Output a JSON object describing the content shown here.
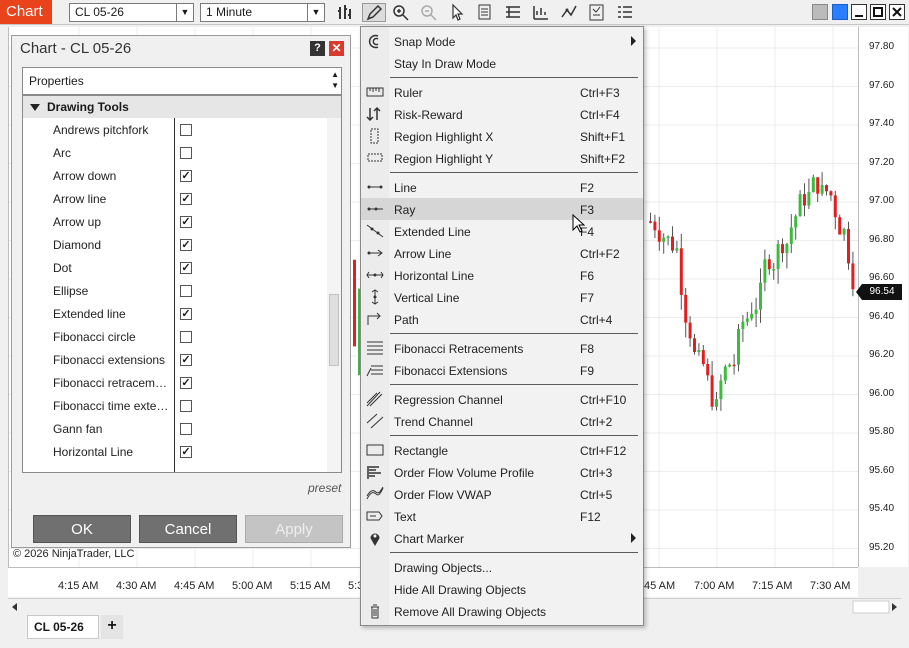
{
  "toolbar": {
    "chart_label": "Chart",
    "instrument": "CL 05-26",
    "interval": "1 Minute"
  },
  "dialog": {
    "title": "Chart - CL 05-26",
    "help_label": "?",
    "close_label": "✕",
    "properties_label": "Properties",
    "section_label": "Drawing Tools",
    "items": [
      {
        "label": "Andrews pitchfork",
        "checked": false
      },
      {
        "label": "Arc",
        "checked": false
      },
      {
        "label": "Arrow down",
        "checked": true
      },
      {
        "label": "Arrow line",
        "checked": true
      },
      {
        "label": "Arrow up",
        "checked": true
      },
      {
        "label": "Diamond",
        "checked": true
      },
      {
        "label": "Dot",
        "checked": true
      },
      {
        "label": "Ellipse",
        "checked": false
      },
      {
        "label": "Extended line",
        "checked": true
      },
      {
        "label": "Fibonacci circle",
        "checked": false
      },
      {
        "label": "Fibonacci extensions",
        "checked": true
      },
      {
        "label": "Fibonacci retracements",
        "checked": true
      },
      {
        "label": "Fibonacci time extensions",
        "checked": false
      },
      {
        "label": "Gann fan",
        "checked": false
      },
      {
        "label": "Horizontal Line",
        "checked": true
      }
    ],
    "preset_label": "preset",
    "ok_label": "OK",
    "cancel_label": "Cancel",
    "apply_label": "Apply"
  },
  "copyright": "© 2026 NinjaTrader, LLC",
  "menu": {
    "items": [
      {
        "label": "Snap Mode",
        "shortcut": "",
        "submenu": true,
        "icon": "snap-icon"
      },
      {
        "label": "Stay In Draw Mode",
        "shortcut": "",
        "icon": ""
      },
      {
        "label": "Ruler",
        "shortcut": "Ctrl+F3",
        "icon": "ruler-icon"
      },
      {
        "label": "Risk-Reward",
        "shortcut": "Ctrl+F4",
        "icon": "risk-reward-icon"
      },
      {
        "label": "Region Highlight X",
        "shortcut": "Shift+F1",
        "icon": "region-x-icon"
      },
      {
        "label": "Region Highlight Y",
        "shortcut": "Shift+F2",
        "icon": "region-y-icon"
      },
      {
        "label": "Line",
        "shortcut": "F2",
        "icon": "line-icon"
      },
      {
        "label": "Ray",
        "shortcut": "F3",
        "icon": "ray-icon",
        "highlighted": true
      },
      {
        "label": "Extended Line",
        "shortcut": "F4",
        "icon": "extended-line-icon"
      },
      {
        "label": "Arrow Line",
        "shortcut": "Ctrl+F2",
        "icon": "arrow-line-icon"
      },
      {
        "label": "Horizontal Line",
        "shortcut": "F6",
        "icon": "horizontal-line-icon"
      },
      {
        "label": "Vertical Line",
        "shortcut": "F7",
        "icon": "vertical-line-icon"
      },
      {
        "label": "Path",
        "shortcut": "Ctrl+4",
        "icon": "path-icon"
      },
      {
        "label": "Fibonacci Retracements",
        "shortcut": "F8",
        "icon": "fib-retracement-icon"
      },
      {
        "label": "Fibonacci Extensions",
        "shortcut": "F9",
        "icon": "fib-extension-icon"
      },
      {
        "label": "Regression Channel",
        "shortcut": "Ctrl+F10",
        "icon": "regression-channel-icon"
      },
      {
        "label": "Trend Channel",
        "shortcut": "Ctrl+2",
        "icon": "trend-channel-icon"
      },
      {
        "label": "Rectangle",
        "shortcut": "Ctrl+F12",
        "icon": "rectangle-icon"
      },
      {
        "label": "Order Flow Volume Profile",
        "shortcut": "Ctrl+3",
        "icon": "volume-profile-icon"
      },
      {
        "label": "Order Flow VWAP",
        "shortcut": "Ctrl+5",
        "icon": "vwap-icon"
      },
      {
        "label": "Text",
        "shortcut": "F12",
        "icon": "text-icon"
      },
      {
        "label": "Chart Marker",
        "shortcut": "",
        "submenu": true,
        "icon": "marker-icon"
      },
      {
        "label": "Drawing Objects...",
        "shortcut": "",
        "icon": ""
      },
      {
        "label": "Hide All Drawing Objects",
        "shortcut": "",
        "icon": ""
      },
      {
        "label": "Remove All Drawing Objects",
        "shortcut": "",
        "icon": "trash-icon"
      }
    ]
  },
  "chart": {
    "y_ticks": [
      "97.80",
      "97.60",
      "97.40",
      "97.20",
      "97.00",
      "96.80",
      "96.60",
      "96.40",
      "96.20",
      "96.00",
      "95.80",
      "95.60",
      "95.40",
      "95.20"
    ],
    "last_price": "96.54",
    "x_ticks": [
      "4:15 AM",
      "4:30 AM",
      "4:45 AM",
      "5:00 AM",
      "5:15 AM",
      "5:3",
      "45 AM",
      "7:00 AM",
      "7:15 AM",
      "7:30 AM"
    ],
    "up_color": "#3dbb3d",
    "down_color": "#e02020"
  },
  "tabs": {
    "active": "CL 05-26",
    "add_label": "+"
  }
}
